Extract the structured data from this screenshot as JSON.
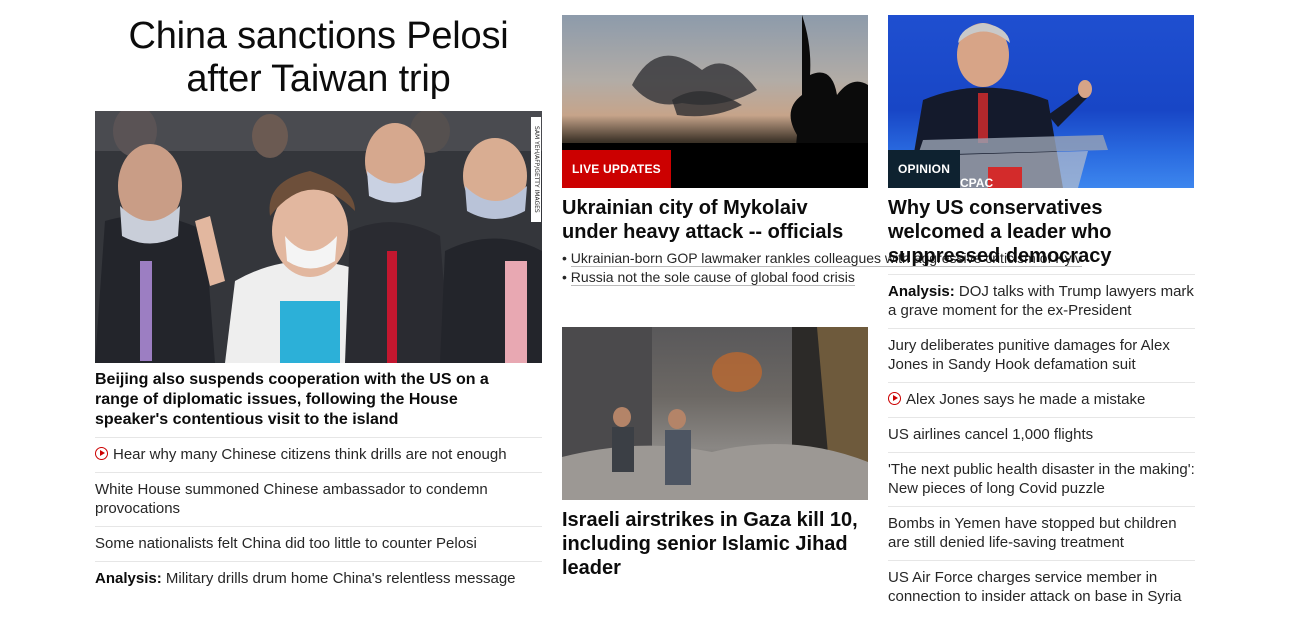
{
  "col1": {
    "headline": "China sanctions Pelosi after Taiwan trip",
    "image_credit": "SAM YEH/AFP/GETTY IMAGES",
    "sub_headline": "Beijing also suspends cooperation with the US on a range of diplomatic issues, following the House speaker's contentious visit to the island",
    "links": [
      {
        "text": "Hear why many Chinese citizens think drills are not enough",
        "icon": "play-circle-icon"
      },
      {
        "text": "White House summoned Chinese ambassador to condemn provocations"
      },
      {
        "text": "Some nationalists felt China did too little to counter Pelosi"
      },
      {
        "prefix": "Analysis:",
        "text": " Military drills drum home China's relentless message"
      }
    ]
  },
  "col2": {
    "card1": {
      "badge": "LIVE UPDATES",
      "badge_color": "#cc0000",
      "headline": "Ukrainian city of Mykolaiv under heavy attack -- officials",
      "bullets": [
        "Ukrainian-born GOP lawmaker rankles colleagues with aggressive criticism of Kyiv",
        "Russia not the sole cause of global food crisis"
      ]
    },
    "card2": {
      "headline": "Israeli airstrikes in Gaza kill 10, including senior Islamic Jihad leader"
    }
  },
  "col3": {
    "card": {
      "badge": "OPINION",
      "badge_color": "#0e2230",
      "stage_sign": "CPAC",
      "headline": "Why US conservatives welcomed a leader who suppressed democracy"
    },
    "links": [
      {
        "prefix": "Analysis:",
        "text": " DOJ talks with Trump lawyers mark a grave moment for the ex-President"
      },
      {
        "text": "Jury deliberates punitive damages for Alex Jones in Sandy Hook defamation suit"
      },
      {
        "text": "Alex Jones says he made a mistake",
        "icon": "play-circle-icon"
      },
      {
        "text": "US airlines cancel 1,000 flights"
      },
      {
        "text": "'The next public health disaster in the making': New pieces of long Covid puzzle"
      },
      {
        "text": "Bombs in Yemen have stopped but children are still denied life-saving treatment"
      },
      {
        "text": "US Air Force charges service member in connection to insider attack on base in Syria"
      }
    ]
  }
}
